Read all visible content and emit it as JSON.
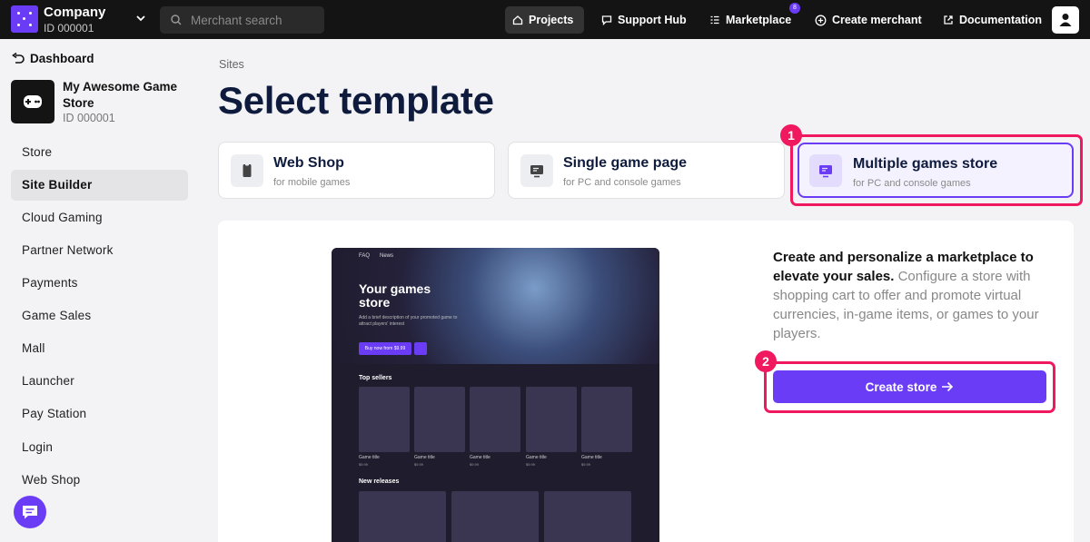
{
  "company": {
    "name": "Company",
    "id": "ID 000001"
  },
  "search": {
    "placeholder": "Merchant search"
  },
  "topnav": {
    "projects": "Projects",
    "support_hub": "Support Hub",
    "marketplace": "Marketplace",
    "marketplace_badge": "8",
    "create_merchant": "Create merchant",
    "documentation": "Documentation"
  },
  "sidebar": {
    "back_label": "Dashboard",
    "project_name": "My Awesome Game Store",
    "project_id": "ID 000001",
    "items": [
      {
        "label": "Store"
      },
      {
        "label": "Site Builder"
      },
      {
        "label": "Cloud Gaming"
      },
      {
        "label": "Partner Network"
      },
      {
        "label": "Payments"
      },
      {
        "label": "Game Sales"
      },
      {
        "label": "Mall"
      },
      {
        "label": "Launcher"
      },
      {
        "label": "Pay Station"
      },
      {
        "label": "Login"
      },
      {
        "label": "Web Shop"
      }
    ],
    "active_index": 1
  },
  "breadcrumb": "Sites",
  "page_title": "Select template",
  "templates": [
    {
      "title": "Web Shop",
      "subtitle": "for mobile games",
      "icon": "phone-icon"
    },
    {
      "title": "Single game page",
      "subtitle": "for PC and console games",
      "icon": "monitor-icon"
    },
    {
      "title": "Multiple games store",
      "subtitle": "for PC and console games",
      "icon": "monitor-icon",
      "selected": true
    }
  ],
  "annotations": {
    "step1": "1",
    "step2": "2"
  },
  "preview": {
    "nav": [
      "FAQ",
      "News"
    ],
    "title": "Your games store",
    "description": "Add a brief description of your promoted game to attract players' interest",
    "buy_button": "Buy now from $9.99",
    "top_sellers": "Top sellers",
    "game_title": "Game title",
    "game_price": "$9.99",
    "new_releases": "New releases"
  },
  "description": {
    "lead": "Create and personalize a marketplace to elevate your sales.",
    "body": " Configure a store with shopping cart to offer and promote virtual currencies, in-game items, or games to your players."
  },
  "create_button": "Create store",
  "colors": {
    "accent": "#6b3cf5",
    "highlight": "#f0185e",
    "topbar": "#141414",
    "title": "#0e1b3d"
  }
}
